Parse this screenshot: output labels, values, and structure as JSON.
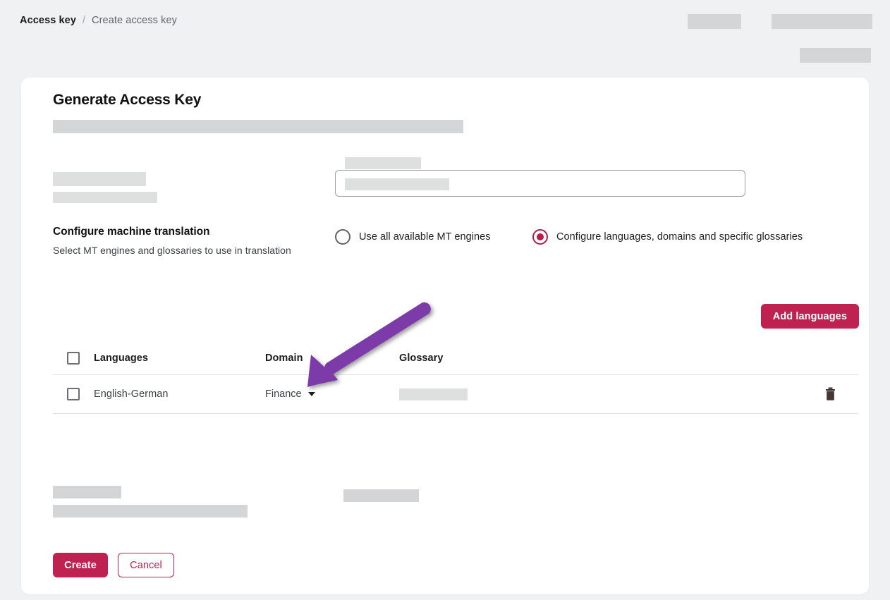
{
  "breadcrumb": {
    "current": "Access key",
    "separator": "/",
    "next": "Create access key"
  },
  "card": {
    "title": "Generate Access Key"
  },
  "mt_section": {
    "heading": "Configure machine translation",
    "subtext": "Select MT engines and glossaries to use in translation",
    "options": [
      {
        "label": "Use all available MT engines",
        "selected": false
      },
      {
        "label": "Configure languages, domains and specific glossaries",
        "selected": true
      }
    ]
  },
  "toolbar": {
    "add_languages_label": "Add languages"
  },
  "table": {
    "headers": {
      "languages": "Languages",
      "domain": "Domain",
      "glossary": "Glossary"
    },
    "rows": [
      {
        "languages": "English-German",
        "domain": "Finance",
        "glossary": "",
        "delete_icon": "trash-icon"
      }
    ]
  },
  "footer": {
    "create_label": "Create",
    "cancel_label": "Cancel"
  },
  "colors": {
    "accent": "#bf2150",
    "radio_selected": "#b51c4a",
    "annotation_arrow": "#7b3aa8",
    "page_background": "#f0f1f2",
    "card_background": "#ffffff",
    "redacted_block": "#d4d5d6"
  },
  "annotation": {
    "arrow": "purple-arrow-pointing-to-domain-dropdown"
  }
}
